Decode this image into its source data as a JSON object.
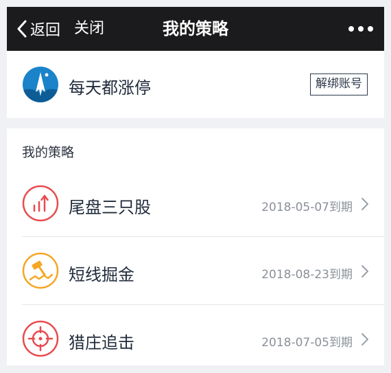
{
  "navbar": {
    "back_label": "返回",
    "close_label": "关闭",
    "title": "我的策略"
  },
  "account": {
    "name": "每天都涨停",
    "unbind_label": "解绑账号"
  },
  "strategies": {
    "section_title": "我的策略",
    "items": [
      {
        "label": "尾盘三只股",
        "expiry": "2018-05-07到期",
        "icon": "rising-bars-icon",
        "color": "#e84a4f"
      },
      {
        "label": "短线掘金",
        "expiry": "2018-08-23到期",
        "icon": "gold-hammer-icon",
        "color": "#f5a623"
      },
      {
        "label": "猎庄追击",
        "expiry": "2018-07-05到期",
        "icon": "crosshair-target-icon",
        "color": "#e84a4f"
      }
    ]
  },
  "colors": {
    "navbar_bg": "#1b1b1d",
    "page_bg": "#eff1f4",
    "accent_red": "#e84a4f",
    "accent_orange": "#f5a623",
    "avatar_blue": "#1a83c9"
  }
}
